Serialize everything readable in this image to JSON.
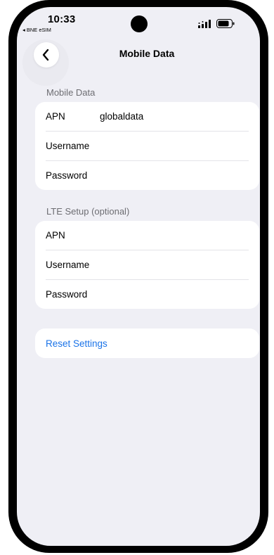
{
  "status_bar": {
    "time": "10:33",
    "carrier": "◂ BNE eSIM"
  },
  "nav": {
    "title": "Mobile Data",
    "back_icon": "chevron-left-icon"
  },
  "mobile_data": {
    "section_label": "Mobile Data",
    "rows": [
      {
        "label": "APN",
        "value": "globaldata"
      },
      {
        "label": "Username",
        "value": ""
      },
      {
        "label": "Password",
        "value": ""
      }
    ]
  },
  "lte_setup": {
    "section_label": "LTE Setup (optional)",
    "rows": [
      {
        "label": "APN",
        "value": ""
      },
      {
        "label": "Username",
        "value": ""
      },
      {
        "label": "Password",
        "value": ""
      }
    ]
  },
  "reset": {
    "label": "Reset Settings"
  },
  "colors": {
    "background": "#efeff5",
    "card": "#ffffff",
    "link": "#1a73e8",
    "section_label": "#6d6d72"
  }
}
